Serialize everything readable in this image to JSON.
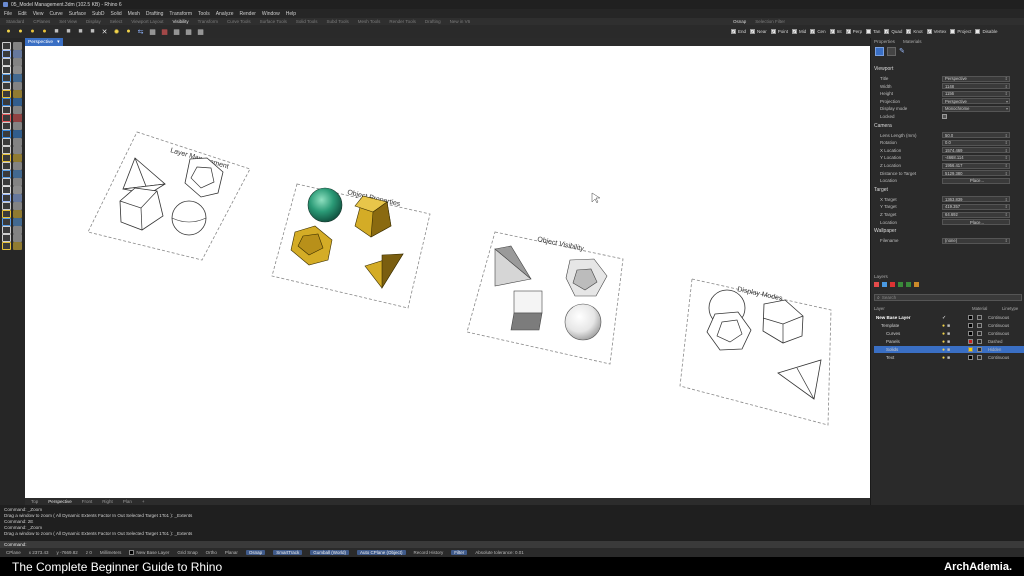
{
  "window": {
    "title": "05_Model Management.3dm (102.5 KB) - Rhino 6"
  },
  "menu": [
    "File",
    "Edit",
    "View",
    "Curve",
    "Surface",
    "SubD",
    "Solid",
    "Mesh",
    "Drafting",
    "Transform",
    "Tools",
    "Analyze",
    "Render",
    "Window",
    "Help"
  ],
  "tabs": [
    "Standard",
    "CPlanes",
    "Set View",
    "Display",
    "Select",
    "Viewport Layout",
    "Visibility",
    "Transform",
    "Curve Tools",
    "Surface Tools",
    "Solid Tools",
    "Subd Tools",
    "Mesh Tools",
    "Render Tools",
    "Drafting",
    "New in V6"
  ],
  "active_tab": "Visibility",
  "osnap": {
    "title": "Osnap",
    "subtitle": "Selection Filter",
    "items": [
      {
        "label": "End",
        "checked": true
      },
      {
        "label": "Near",
        "checked": true
      },
      {
        "label": "Point",
        "checked": true
      },
      {
        "label": "Mid",
        "checked": true
      },
      {
        "label": "Cen",
        "checked": true
      },
      {
        "label": "Int",
        "checked": true
      },
      {
        "label": "Perp",
        "checked": true
      },
      {
        "label": "Tan",
        "checked": false
      },
      {
        "label": "Quad",
        "checked": true
      },
      {
        "label": "Knot",
        "checked": true
      },
      {
        "label": "Vertex",
        "checked": true
      },
      {
        "label": "Project",
        "checked": false
      },
      {
        "label": "Disable",
        "checked": false
      }
    ]
  },
  "viewport": {
    "tab": "Perspective",
    "groups": [
      {
        "label": "Layer Management"
      },
      {
        "label": "Object Properties"
      },
      {
        "label": "Object Visibility"
      },
      {
        "label": "Display Modes"
      }
    ],
    "bottom_tabs": [
      "Top",
      "Perspective",
      "Front",
      "Right",
      "Plan",
      "+"
    ],
    "active_bottom": "Perspective"
  },
  "panel": {
    "tabs": [
      "Properties",
      "Materials"
    ],
    "viewport_section": "Viewport",
    "viewport_rows": [
      {
        "label": "Title",
        "value": "Perspective"
      },
      {
        "label": "Width",
        "value": "1148"
      },
      {
        "label": "Height",
        "value": "1156"
      },
      {
        "label": "Projection",
        "value": "Perspective",
        "dropdown": true
      },
      {
        "label": "Display mode",
        "value": "Monochrome",
        "dropdown": true
      },
      {
        "label": "Locked",
        "value": "",
        "check": true
      }
    ],
    "camera_section": "Camera",
    "camera_rows": [
      {
        "label": "Lens Length (mm)",
        "value": "50.0"
      },
      {
        "label": "Rotation",
        "value": "0.0"
      },
      {
        "label": "X Location",
        "value": "1574.469"
      },
      {
        "label": "Y Location",
        "value": "-4668.114"
      },
      {
        "label": "Z Location",
        "value": "1956.417"
      },
      {
        "label": "Distance to Target",
        "value": "5129.380"
      },
      {
        "label": "Location",
        "value": "Place...",
        "button": true
      }
    ],
    "target_section": "Target",
    "target_rows": [
      {
        "label": "X Target",
        "value": "1363.839"
      },
      {
        "label": "Y Target",
        "value": "419.357"
      },
      {
        "label": "Z Target",
        "value": "64.692"
      },
      {
        "label": "Location",
        "value": "Place...",
        "button": true
      }
    ],
    "wallpaper_section": "Wallpaper",
    "wallpaper_rows": [
      {
        "label": "Filename",
        "value": "(none)"
      }
    ],
    "layers_label": "Layers",
    "search_placeholder": "Search",
    "layer_columns": [
      "Layer",
      "Material",
      "Linetype"
    ],
    "layers": [
      {
        "name": "New Base Layer",
        "linetype": "Continuous",
        "bold": true,
        "indent": 0,
        "color": "#000000",
        "selected": false
      },
      {
        "name": "Template",
        "linetype": "Continuous",
        "bold": false,
        "indent": 1,
        "color": "#000000",
        "selected": false
      },
      {
        "name": "Curves",
        "linetype": "Continuous",
        "bold": false,
        "indent": 2,
        "color": "#000000",
        "selected": false
      },
      {
        "name": "Panels",
        "linetype": "Dashed",
        "bold": false,
        "indent": 2,
        "color": "#c81e1e",
        "selected": false
      },
      {
        "name": "Solids",
        "linetype": "Hidden",
        "bold": false,
        "indent": 2,
        "color": "#f0d000",
        "selected": true
      },
      {
        "name": "Text",
        "linetype": "Continuous",
        "bold": false,
        "indent": 2,
        "color": "#000000",
        "selected": false
      }
    ]
  },
  "command": {
    "lines": [
      "Command: _Zoom",
      "Drag a window to zoom ( All  Dynamic  Extents  Factor  In  Out  Selected  Target  1To1 ): _Extents",
      "Command: 2E",
      "Command: _Zoom",
      "Drag a window to zoom ( All  Dynamic  Extents  Factor  In  Out  Selected  Target  1To1 ): _Extents"
    ],
    "prompt": "Command:"
  },
  "status": {
    "cplane": "CPlane",
    "x": "x 2373.43",
    "y": "y -7669.82",
    "z": "z 0",
    "units": "Millimeters",
    "layer": "New Base Layer",
    "buttons": [
      "Grid Snap",
      "Ortho",
      "Planar",
      "Osnap",
      "SmartTrack",
      "Gumball (World)",
      "Auto CPlane (Object)",
      "Record History",
      "Filter",
      "Absolute tolerance: 0.01"
    ],
    "active": [
      "Osnap",
      "SmartTrack",
      "Gumball (World)",
      "Auto CPlane (Object)",
      "Filter"
    ]
  },
  "banner": {
    "left": "The Complete Beginner Guide to Rhino",
    "right": "ArchAdemia."
  },
  "colors": {
    "accent": "#3a6fc4",
    "viewport_bg": "#ffffff",
    "ui_bg": "#2a2a2a",
    "gold": "#d4ac26",
    "teal": "#2a9a76"
  }
}
